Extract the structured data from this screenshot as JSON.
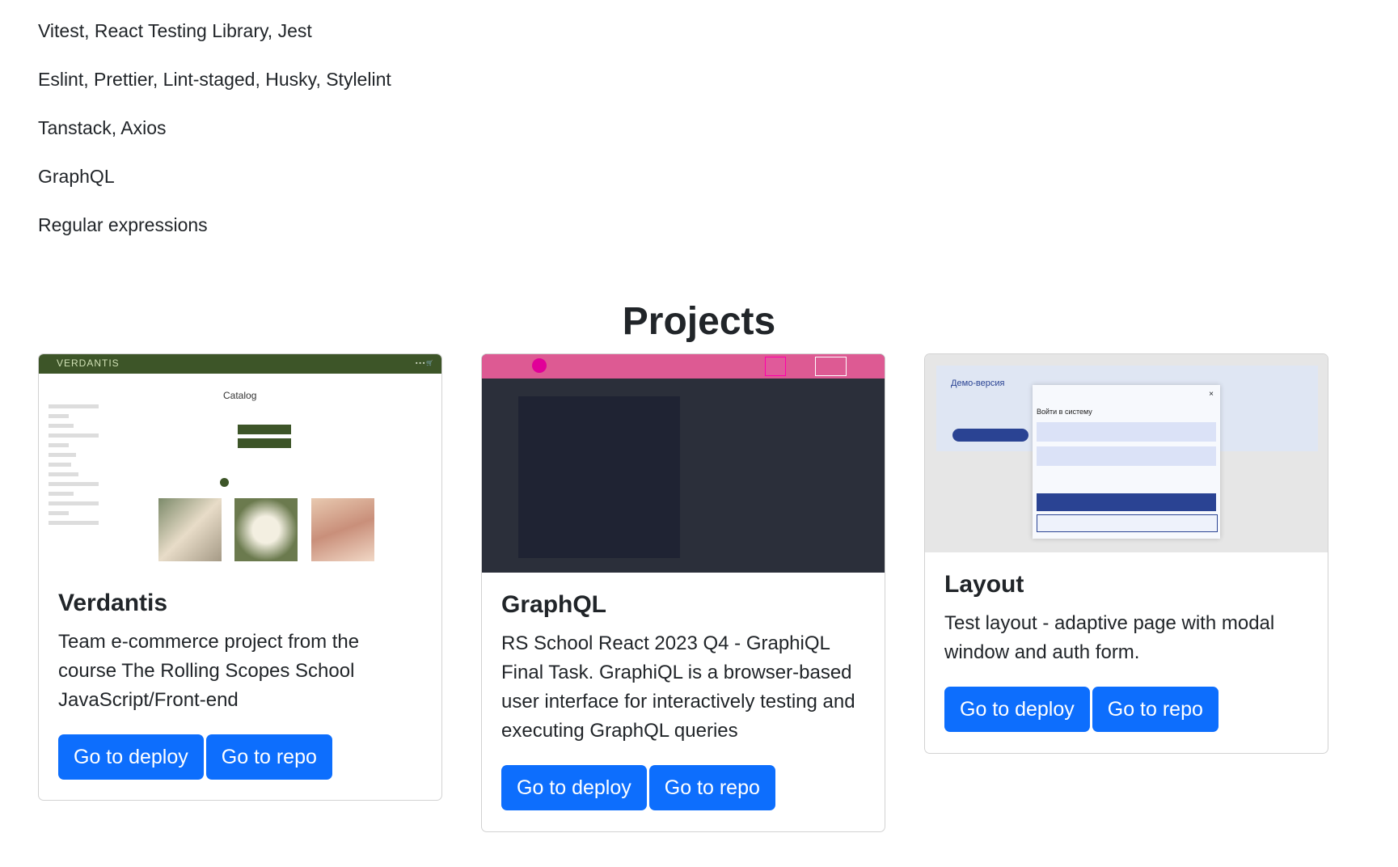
{
  "skills": [
    "Vitest, React Testing Library, Jest",
    "Eslint, Prettier, Lint-staged, Husky, Stylelint",
    "Tanstack, Axios",
    "GraphQL",
    "Regular expressions"
  ],
  "projects": {
    "title": "Projects",
    "cards": [
      {
        "title": "Verdantis",
        "text": "Team e-commerce project from the course The Rolling Scopes School JavaScript/Front-end",
        "deploy_label": "Go to deploy",
        "repo_label": "Go to repo",
        "preview": {
          "logo": "VERDANTIS",
          "heading": "Catalog"
        }
      },
      {
        "title": "GraphQL",
        "text": "RS School React 2023 Q4 - GraphiQL Final Task. GraphiQL is a browser-based user interface for interactively testing and executing GraphQL queries",
        "deploy_label": "Go to deploy",
        "repo_label": "Go to repo"
      },
      {
        "title": "Layout",
        "text": "Test layout - adaptive page with modal window and auth form.",
        "deploy_label": "Go to deploy",
        "repo_label": "Go to repo",
        "preview": {
          "heading": "Демо-версия",
          "modal_title": "Войти в систему"
        }
      }
    ]
  },
  "colors": {
    "primary": "#0d6efd",
    "verdantis_green": "#3d5528",
    "graphql_pink": "#dd5a93"
  }
}
